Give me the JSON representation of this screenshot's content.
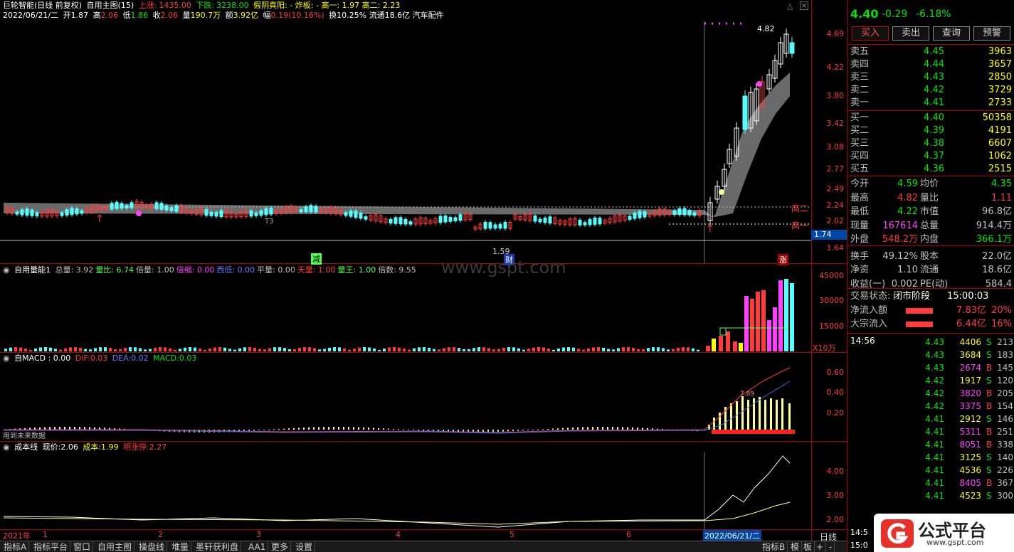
{
  "header": {
    "stock_name": "巨轮智能(日线 前复权)",
    "indicator": "自用主图(15)",
    "up_label": "上涨:",
    "up_value": "1435.00",
    "down_label": "下跌:",
    "down_value": "3238.00",
    "pattern_text": "假阴真阳: - 炸板: - 高一: 1.97 高二: 2.23",
    "date": "2022/06/21/二",
    "open_label": "开",
    "open": "1.87",
    "high_label": "高",
    "high": "2.06",
    "low_label": "低",
    "low": "1.86",
    "close_label": "收",
    "close": "2.06",
    "vol_label": "量",
    "vol": "190.7万",
    "amt_label": "额",
    "amt": "3.92亿",
    "chg_label": "幅",
    "chg": "0.19(10.16%)",
    "turn_text": "换10.25% 流通18.6亿 汽车配件"
  },
  "price_axis": [
    "4.69",
    "4.22",
    "3.80",
    "3.42",
    "3.08",
    "2.77",
    "2.49",
    "2.24",
    "2.02",
    "1.64"
  ],
  "price_tags": {
    "high2": "高二",
    "high1": "高一",
    "current": "1.74",
    "peak": "4.82",
    "low": "1.59",
    "t3": "T3"
  },
  "markers": {
    "jian": "减",
    "cai": "财",
    "zhang": "涨"
  },
  "volume_panel": {
    "title": "自用量能1",
    "items": [
      {
        "label": "总量:",
        "value": "3.92",
        "color": "#c0c0c0"
      },
      {
        "label": "量比:",
        "value": "6.74",
        "color": "#54ff54"
      },
      {
        "label": "倍量:",
        "value": "1.00",
        "color": "#c0c0c0"
      },
      {
        "label": "倍缩:",
        "value": "0.00",
        "color": "#ff40ff"
      },
      {
        "label": "西低:",
        "value": "0.00",
        "color": "#5a7fff"
      },
      {
        "label": "平量:",
        "value": "0.00",
        "color": "#c0c0c0"
      },
      {
        "label": "天量:",
        "value": "1.00",
        "color": "#ff3c3c"
      },
      {
        "label": "量王:",
        "value": "1.00",
        "color": "#54ff54"
      },
      {
        "label": "倍数:",
        "value": "9.55",
        "color": "#c0c0c0"
      }
    ],
    "axis": [
      "45000",
      "30000",
      "15000"
    ],
    "unit": "X10万"
  },
  "watermark": "www.gspt.com",
  "macd_panel": {
    "title": "自MACD",
    "v0": ": 0.00",
    "dif_label": "DIF:",
    "dif": "0.03",
    "dea_label": "DEA:",
    "dea": "0.02",
    "macd_label": "MACD:",
    "macd": "0.03",
    "axis": [
      "0.60",
      "0.40",
      "0.20"
    ],
    "note": "用到未来数据",
    "peak_label": "7.89"
  },
  "cost_panel": {
    "title": "成本线",
    "price_label": "现价:",
    "price": "2.06",
    "cost_label": "成本:",
    "cost": "1.99",
    "limit_label": "明涨停:",
    "limit": "2.27",
    "axis": [
      "4.00",
      "3.00",
      "2.00"
    ]
  },
  "time_axis": {
    "year": "2021年",
    "months": [
      "1",
      "2",
      "3",
      "4",
      "5",
      "6"
    ],
    "cursor_date": "2022/06/21/二",
    "period": "日线"
  },
  "tabs": [
    "指标A",
    "指标平台",
    "窗口",
    "自用主图",
    "操盘线",
    "堆量",
    "墨轩获利盘",
    "AA1",
    "更多",
    "设置"
  ],
  "tabs_right": [
    "指标B",
    "模",
    "板",
    "+",
    "-"
  ],
  "quote": {
    "price": "4.40",
    "change": "-0.29",
    "pct": "-6.18%",
    "buttons": [
      "买入",
      "卖出",
      "查询",
      "预警"
    ],
    "asks": [
      {
        "label": "卖五",
        "price": "4.45",
        "vol": "3963"
      },
      {
        "label": "卖四",
        "price": "4.44",
        "vol": "3657"
      },
      {
        "label": "卖三",
        "price": "4.43",
        "vol": "2850"
      },
      {
        "label": "卖二",
        "price": "4.42",
        "vol": "3729"
      },
      {
        "label": "卖一",
        "price": "4.41",
        "vol": "2733"
      }
    ],
    "bids": [
      {
        "label": "买一",
        "price": "4.40",
        "vol": "50358"
      },
      {
        "label": "买二",
        "price": "4.39",
        "vol": "4191"
      },
      {
        "label": "买三",
        "price": "4.38",
        "vol": "6607"
      },
      {
        "label": "买四",
        "price": "4.37",
        "vol": "1062"
      },
      {
        "label": "买五",
        "price": "4.36",
        "vol": "2515"
      }
    ],
    "stats": [
      {
        "l1": "今开",
        "v1": "4.59",
        "c1": "#00e600",
        "l2": "均价",
        "v2": "4.35",
        "c2": "#00e600"
      },
      {
        "l1": "最高",
        "v1": "4.82",
        "c1": "#ff3c3c",
        "l2": "量比",
        "v2": "1.11",
        "c2": "#ff3c3c"
      },
      {
        "l1": "最低",
        "v1": "4.22",
        "c1": "#00e600",
        "l2": "市值",
        "v2": "96.8亿",
        "c2": "#c0c0c0"
      },
      {
        "l1": "现量",
        "v1": "167614",
        "c1": "#ff40ff",
        "l2": "总量",
        "v2": "914.4万",
        "c2": "#c0c0c0"
      },
      {
        "l1": "外盘",
        "v1": "548.2万",
        "c1": "#ff3c3c",
        "l2": "内盘",
        "v2": "366.1万",
        "c2": "#00e600"
      },
      {
        "l1": "换手",
        "v1": "49.12%",
        "c1": "#c0c0c0",
        "l2": "股本",
        "v2": "22.0亿",
        "c2": "#c0c0c0"
      },
      {
        "l1": "净资",
        "v1": "1.10",
        "c1": "#c0c0c0",
        "l2": "流通",
        "v2": "18.6亿",
        "c2": "#c0c0c0"
      },
      {
        "l1": "收益(一)",
        "v1": "0.002",
        "c1": "#c0c0c0",
        "l2": "PE(动)",
        "v2": "584.4",
        "c2": "#c0c0c0"
      }
    ],
    "status_label": "交易状态:",
    "status_value": "闭市阶段",
    "status_time": "15:00:03",
    "flow": [
      {
        "label": "净流入额",
        "value": "7.83亿",
        "pct": "20%"
      },
      {
        "label": "大宗流入",
        "value": "6.44亿",
        "pct": "16%"
      }
    ],
    "tick_time": "14:56",
    "ticks": [
      {
        "p": "4.43",
        "v": "4406",
        "bs": "S",
        "n": "213"
      },
      {
        "p": "4.43",
        "v": "3684",
        "bs": "S",
        "n": "183"
      },
      {
        "p": "4.43",
        "v": "2674",
        "bs": "B",
        "n": "145"
      },
      {
        "p": "4.42",
        "v": "1917",
        "bs": "S",
        "n": "120"
      },
      {
        "p": "4.42",
        "v": "3820",
        "bs": "B",
        "n": "205"
      },
      {
        "p": "4.42",
        "v": "3375",
        "bs": "B",
        "n": "154"
      },
      {
        "p": "4.41",
        "v": "2912",
        "bs": "S",
        "n": "146"
      },
      {
        "p": "4.41",
        "v": "5311",
        "bs": "B",
        "n": "251"
      },
      {
        "p": "4.41",
        "v": "8051",
        "bs": "B",
        "n": "338"
      },
      {
        "p": "4.41",
        "v": "3125",
        "bs": "S",
        "n": "140"
      },
      {
        "p": "4.41",
        "v": "4536",
        "bs": "S",
        "n": "226"
      },
      {
        "p": "4.41",
        "v": "8405",
        "bs": "B",
        "n": "367"
      },
      {
        "p": "4.41",
        "v": "4523",
        "bs": "S",
        "n": "300"
      }
    ],
    "bottom_times": [
      "14:5",
      "15:0"
    ]
  },
  "logo": {
    "text": "公式平台",
    "url": "www.gspt.com"
  },
  "colors": {
    "up": "#ff3c3c",
    "down": "#54ffff",
    "grid": "#aa0000",
    "green": "#00e600",
    "yellow": "#ffff00",
    "magenta": "#ff40ff"
  }
}
